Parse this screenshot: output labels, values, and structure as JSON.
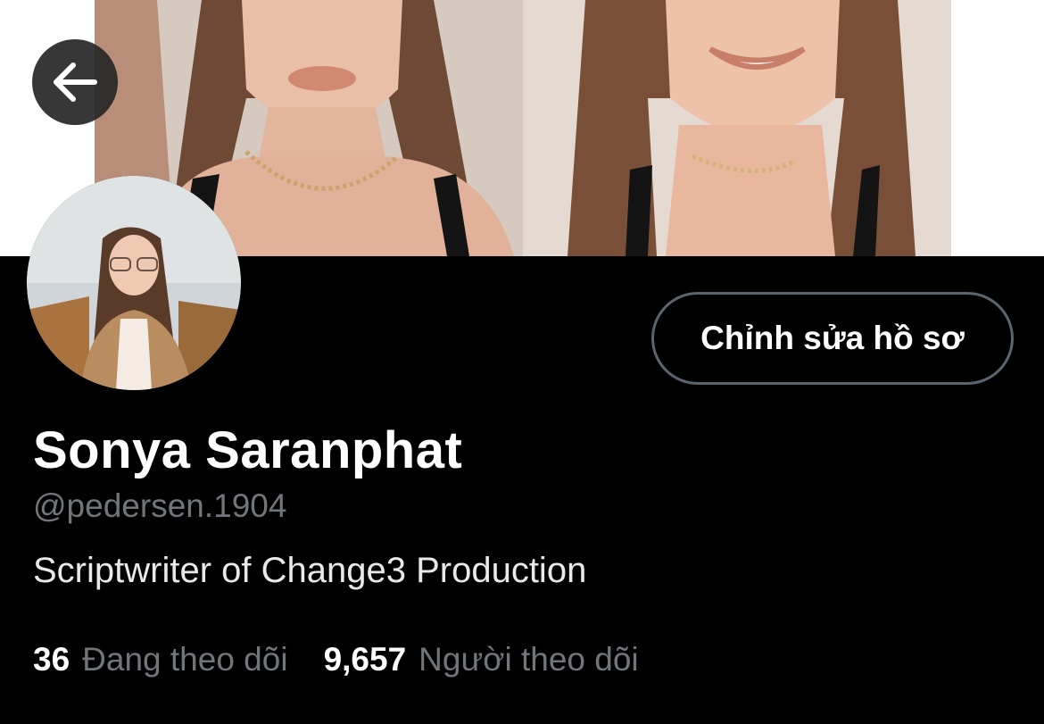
{
  "header": {
    "back_icon": "arrow-left-icon"
  },
  "profile": {
    "display_name": "Sonya Saranphat",
    "handle": "@pedersen.1904",
    "bio": "Scriptwriter of Change3 Production",
    "edit_button_label": "Chỉnh sửa hồ sơ"
  },
  "stats": [
    {
      "count": "36",
      "label": "Đang theo dõi"
    },
    {
      "count": "9,657",
      "label": "Người theo dõi"
    }
  ],
  "colors": {
    "background": "#000000",
    "primary_text": "#ffffff",
    "secondary_text": "#71767b",
    "button_border": "#5b6570"
  }
}
